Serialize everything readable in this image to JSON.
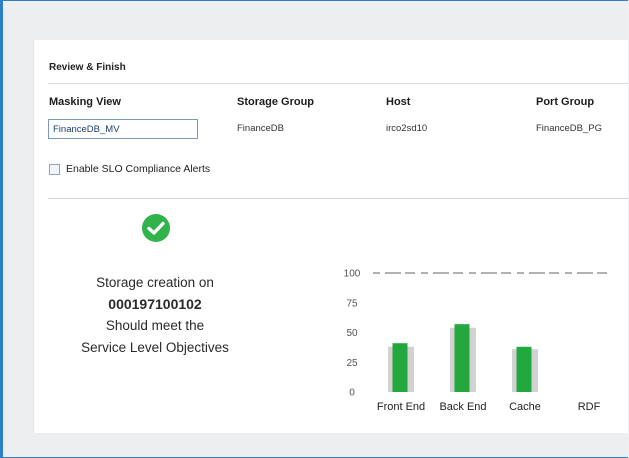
{
  "section_title": "Review & Finish",
  "columns": {
    "masking_view": {
      "header": "Masking View",
      "value": "FinanceDB_MV"
    },
    "storage_group": {
      "header": "Storage Group",
      "value": "FinanceDB"
    },
    "host": {
      "header": "Host",
      "value": "irco2sd10"
    },
    "port_group": {
      "header": "Port Group",
      "value": "FinanceDB_PG"
    }
  },
  "slo_alerts": {
    "label": "Enable SLO Compliance Alerts",
    "checked": false
  },
  "status": {
    "icon": "check-circle-icon",
    "line1": "Storage creation on",
    "line2": "000197100102",
    "line3": "Should meet the",
    "line4": "Service Level Objectives"
  },
  "colors": {
    "accent_border": "#2f7fc8",
    "success_green": "#2fb34a",
    "bar_green": "#22a83c",
    "bar_back": "#d2d2d2"
  },
  "chart_data": {
    "type": "bar",
    "categories": [
      "Front End",
      "Back End",
      "Cache",
      "RDF"
    ],
    "series": [
      {
        "values": [
          41,
          57,
          38,
          null
        ]
      },
      {
        "values": [
          38,
          54,
          36,
          null
        ]
      }
    ],
    "yticks": [
      0,
      25,
      50,
      75,
      100
    ],
    "ylim": [
      0,
      100
    ],
    "reference_line": 100,
    "grid": false
  }
}
